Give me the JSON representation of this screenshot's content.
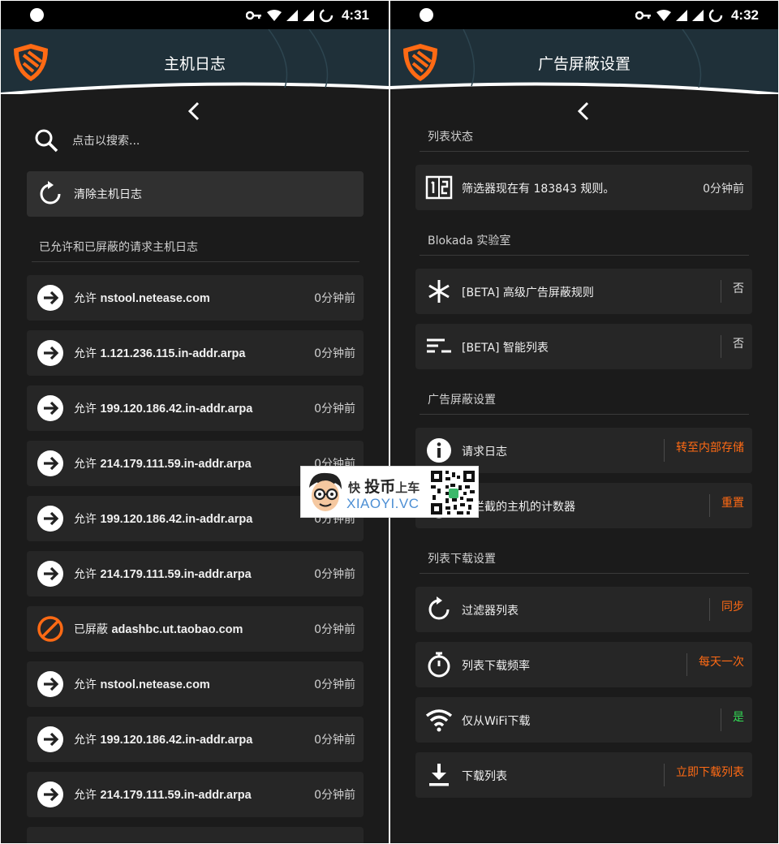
{
  "status_bar": {
    "left_time": "4:31",
    "right_time": "4:32"
  },
  "left": {
    "title": "主机日志",
    "search_placeholder": "点击以搜索...",
    "clear_label": "清除主机日志",
    "section": "已允许和已屏蔽的请求主机日志",
    "entries": [
      {
        "prefix": "允许",
        "host": "nstool.netease.com",
        "time": "0分钟前",
        "icon": "arrow-right-icon"
      },
      {
        "prefix": "允许",
        "host": "1.121.236.115.in-addr.arpa",
        "time": "0分钟前",
        "icon": "arrow-right-icon"
      },
      {
        "prefix": "允许",
        "host": "199.120.186.42.in-addr.arpa",
        "time": "0分钟前",
        "icon": "arrow-right-icon"
      },
      {
        "prefix": "允许",
        "host": "214.179.111.59.in-addr.arpa",
        "time": "0分钟前",
        "icon": "arrow-right-icon"
      },
      {
        "prefix": "允许",
        "host": "199.120.186.42.in-addr.arpa",
        "time": "0分钟前",
        "icon": "arrow-right-icon"
      },
      {
        "prefix": "允许",
        "host": "214.179.111.59.in-addr.arpa",
        "time": "0分钟前",
        "icon": "arrow-right-icon"
      },
      {
        "prefix": "已屏蔽",
        "host": "adashbc.ut.taobao.com",
        "time": "0分钟前",
        "icon": "blocked-icon"
      },
      {
        "prefix": "允许",
        "host": "nstool.netease.com",
        "time": "0分钟前",
        "icon": "arrow-right-icon"
      },
      {
        "prefix": "允许",
        "host": "199.120.186.42.in-addr.arpa",
        "time": "0分钟前",
        "icon": "arrow-right-icon"
      },
      {
        "prefix": "允许",
        "host": "214.179.111.59.in-addr.arpa",
        "time": "0分钟前",
        "icon": "arrow-right-icon"
      }
    ]
  },
  "right": {
    "title": "广告屏蔽设置",
    "sections": {
      "list_status": "列表状态",
      "lab": "Blokada 实验室",
      "adblock": "广告屏蔽设置",
      "download": "列表下载设置"
    },
    "filter_rules": {
      "label": "筛选器现在有 183843 规则。",
      "value": "0分钟前"
    },
    "advanced_rules": {
      "label": "[BETA] 高级广告屏蔽规则",
      "value": "否"
    },
    "smart_list": {
      "label": "[BETA] 智能列表",
      "value": "否"
    },
    "request_log": {
      "label": "请求日志",
      "value": "转至内部存储"
    },
    "blocked_counter": {
      "label": "已拦截的主机的计数器",
      "value": "重置"
    },
    "filter_list": {
      "label": "过滤器列表",
      "value": "同步"
    },
    "download_freq": {
      "label": "列表下载频率",
      "value": "每天一次"
    },
    "wifi_only": {
      "label": "仅从WiFi下载",
      "value": "是"
    },
    "download_list": {
      "label": "下载列表",
      "value": "立即下载列表"
    }
  },
  "watermark": {
    "line1_a": "快",
    "line1_b": "投币",
    "line1_c": "上车",
    "line2": "XIAOYI.VC"
  },
  "colors": {
    "accent": "#ff6a14",
    "green": "#33dd55",
    "background": "#1b1b1b",
    "card": "#262626"
  }
}
